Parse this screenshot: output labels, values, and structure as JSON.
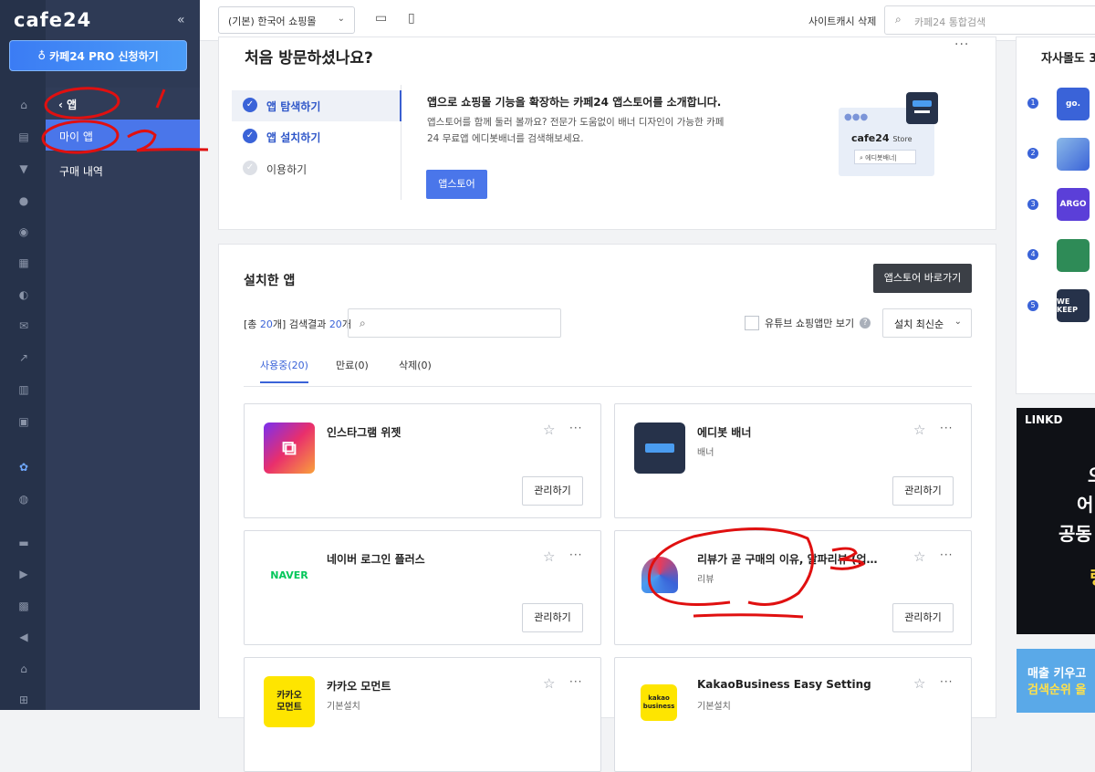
{
  "brand": "cafe24",
  "collapse_icon": "«",
  "pro_button": "카페24 PRO 신청하기",
  "submenu": {
    "back_label": "앱",
    "items": [
      "마이 앱",
      "구매 내역"
    ]
  },
  "topbar": {
    "shop_select": "(기본) 한국어 쇼핑몰",
    "cache_delete": "사이트캐시 삭제",
    "search_placeholder": "카페24 통합검색"
  },
  "welcome": {
    "title": "처음 방문하셨나요?",
    "steps": [
      "앱 탐색하기",
      "앱 설치하기",
      "이용하기"
    ],
    "intro_head": "앱으로 쇼핑몰 기능을 확장하는 카페24 앱스토어를 소개합니다.",
    "intro_desc": "앱스토어를 함께 둘러 볼까요? 전문가 도움없이 배너 디자인이 가능한 카페24 무료앱 에디봇배너를 검색해보세요.",
    "button": "앱스토어",
    "illus_logo": "cafe24",
    "illus_store": "Store",
    "illus_search": "에디봇배너|"
  },
  "installed": {
    "title": "설치한 앱",
    "store_button": "앱스토어 바로가기",
    "count_prefix": "[총 ",
    "total": "20",
    "count_mid": "개] 검색결과 ",
    "results": "20",
    "count_suffix": "개",
    "youtube_filter": "유튜브 쇼핑앱만 보기",
    "sort": "설치 최신순",
    "tabs": [
      "사용중(20)",
      "만료(0)",
      "삭제(0)"
    ],
    "manage_label": "관리하기",
    "apps": [
      {
        "name": "인스타그램 위젯",
        "category": ""
      },
      {
        "name": "에디봇 배너",
        "category": "배너"
      },
      {
        "name": "네이버 로그인 플러스",
        "category": "",
        "logo": "NAVER"
      },
      {
        "name": "리뷰가 곧 구매의 이유, 알파리뷰 (업…",
        "category": "리뷰"
      },
      {
        "name": "카카오 모먼트",
        "category": "기본설치",
        "logo": "카카오\n모먼트"
      },
      {
        "name": "KakaoBusiness Easy Setting",
        "category": "기본설치",
        "logo": "kakao\nbusiness"
      }
    ]
  },
  "right": {
    "title": "자사몰도 3",
    "ranks": [
      "1",
      "2",
      "3",
      "4",
      "5"
    ],
    "logos": [
      "go.",
      "",
      "ARGO",
      "",
      "WE KEEP"
    ]
  },
  "ad1": {
    "logo": "LINKD",
    "lines": [
      "오",
      "어",
      "공동",
      "링"
    ]
  },
  "ad2": {
    "lines": [
      "매출 키우고",
      "검색순위 올"
    ]
  },
  "annotations": [
    "1",
    "2",
    "3"
  ],
  "colors": {
    "accent": "#4a76ea",
    "sidebar": "#2e3a55",
    "annotation": "#e01010"
  }
}
